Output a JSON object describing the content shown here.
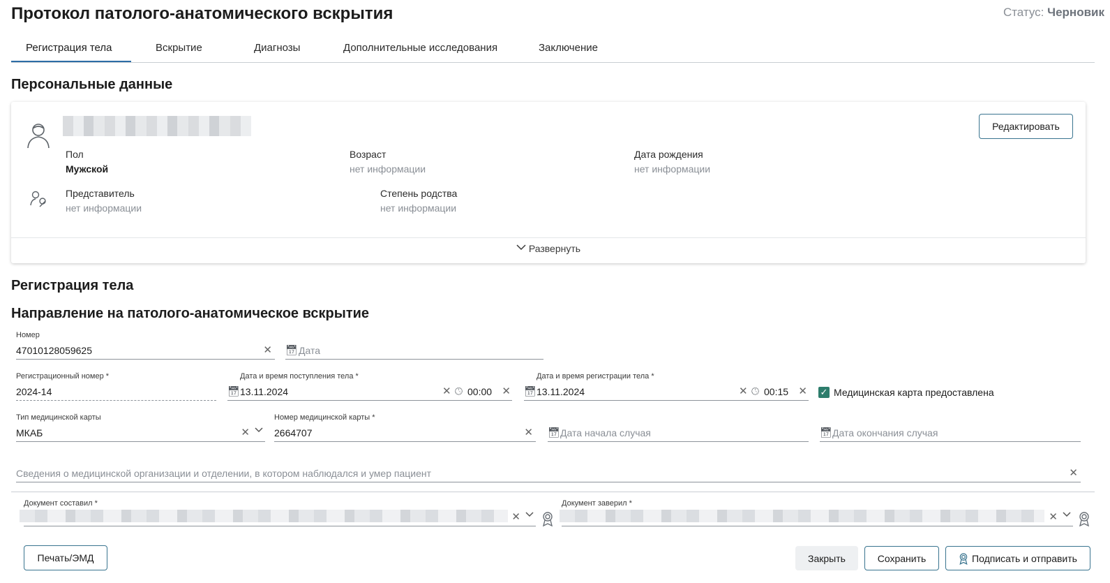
{
  "header": {
    "title": "Протокол патолого-анатомического вскрытия",
    "status_label": "Статус:",
    "status_value": "Черновик"
  },
  "tabs": [
    {
      "label": "Регистрация тела"
    },
    {
      "label": "Вскрытие"
    },
    {
      "label": "Диагнозы"
    },
    {
      "label": "Дополнительные исследования"
    },
    {
      "label": "Заключение"
    }
  ],
  "personal": {
    "heading": "Персональные данные",
    "edit_label": "Редактировать",
    "gender_label": "Пол",
    "gender_value": "Мужской",
    "age_label": "Возраст",
    "age_value": "нет информации",
    "dob_label": "Дата рождения",
    "dob_value": "нет информации",
    "rep_label": "Представитель",
    "rep_value": "нет информации",
    "kin_label": "Степень родства",
    "kin_value": "нет информации",
    "expand_label": "Развернуть"
  },
  "body_reg": {
    "heading": "Регистрация тела",
    "direction_heading": "Направление на патолого-анатомическое вскрытие",
    "number_label": "Номер",
    "number_value": "47010128059625",
    "date_placeholder": "Дата",
    "reg_number_label": "Регистрационный номер *",
    "reg_number_value": "2024-14",
    "arrival_label": "Дата и время поступления тела *",
    "arrival_date": "13.11.2024",
    "arrival_time": "00:00",
    "registration_label": "Дата и время регистрации тела *",
    "registration_date": "13.11.2024",
    "registration_time": "00:15",
    "card_provided_label": "Медицинская карта предоставлена",
    "card_type_label": "Тип медицинской карты",
    "card_type_value": "МКАБ",
    "card_number_label": "Номер медицинской карты *",
    "card_number_value": "2664707",
    "case_start_placeholder": "Дата начала случая",
    "case_end_placeholder": "Дата окончания случая",
    "org_placeholder": "Сведения о медицинской организации и отделении, в котором наблюдался и умер пациент",
    "composed_label": "Документ составил *",
    "certified_label": "Документ заверил *"
  },
  "footer": {
    "print_label": "Печать/ЭМД",
    "close_label": "Закрыть",
    "save_label": "Сохранить",
    "sign_label": "Подписать и отправить"
  }
}
